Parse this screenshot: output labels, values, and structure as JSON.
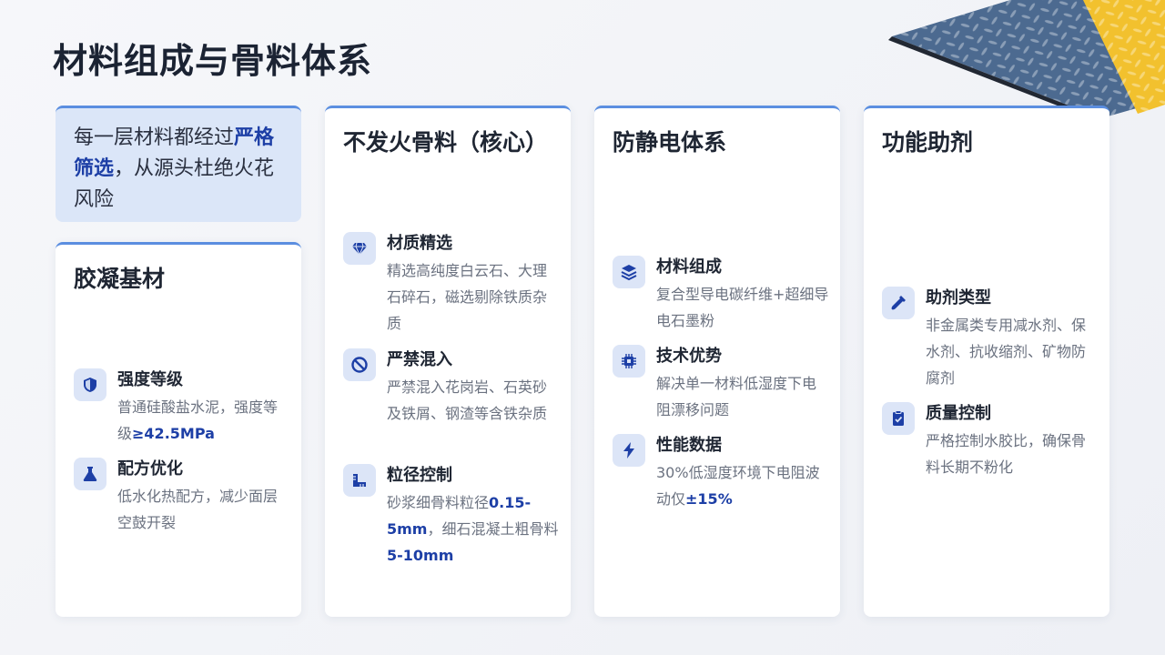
{
  "title": "材料组成与骨料体系",
  "intro": {
    "before": "每一层材料都经过",
    "highlight": "严格筛选",
    "after": "，从源头杜绝火花风险"
  },
  "cards": [
    {
      "title": "胶凝基材",
      "items": [
        {
          "icon": "shield-icon",
          "title": "强度等级",
          "desc_a": "普通硅酸盐水泥，强度等级",
          "num_a": "≥42.5MPa",
          "desc_b": "",
          "num_b": "",
          "desc_c": ""
        },
        {
          "icon": "flask-icon",
          "title": "配方优化",
          "desc_a": "低水化热配方，减少面层空鼓开裂",
          "num_a": "",
          "desc_b": "",
          "num_b": "",
          "desc_c": ""
        }
      ]
    },
    {
      "title": "不发火骨料（核心）",
      "items": [
        {
          "icon": "gem-icon",
          "title": "材质精选",
          "desc_a": "精选高纯度白云石、大理石碎石，磁选剔除铁质杂质",
          "num_a": "",
          "desc_b": "",
          "num_b": "",
          "desc_c": ""
        },
        {
          "icon": "ban-icon",
          "title": "严禁混入",
          "desc_a": "严禁混入花岗岩、石英砂及铁屑、钢渣等含铁杂质",
          "num_a": "",
          "desc_b": "",
          "num_b": "",
          "desc_c": ""
        },
        {
          "icon": "ruler-icon",
          "title": "粒径控制",
          "desc_a": "砂浆细骨料粒径",
          "num_a": "0.15-5mm",
          "desc_b": "，细石混凝土粗骨料",
          "num_b": "5-10mm",
          "desc_c": ""
        }
      ]
    },
    {
      "title": "防静电体系",
      "items": [
        {
          "icon": "layers-icon",
          "title": "材料组成",
          "desc_a": "复合型导电碳纤维+超细导电石墨粉",
          "num_a": "",
          "desc_b": "",
          "num_b": "",
          "desc_c": ""
        },
        {
          "icon": "chip-icon",
          "title": "技术优势",
          "desc_a": "解决单一材料低湿度下电阻漂移问题",
          "num_a": "",
          "desc_b": "",
          "num_b": "",
          "desc_c": ""
        },
        {
          "icon": "bolt-icon",
          "title": "性能数据",
          "desc_a": "30%低湿度环境下电阻波动仅",
          "num_a": "±15%",
          "desc_b": "",
          "num_b": "",
          "desc_c": ""
        }
      ]
    },
    {
      "title": "功能助剂",
      "items": [
        {
          "icon": "dropper-icon",
          "title": "助剂类型",
          "desc_a": "非金属类专用减水剂、保水剂、抗收缩剂、矿物防腐剂",
          "num_a": "",
          "desc_b": "",
          "num_b": "",
          "desc_c": ""
        },
        {
          "icon": "clipboard-check-icon",
          "title": "质量控制",
          "desc_a": "严格控制水胶比，确保骨料长期不粉化",
          "num_a": "",
          "desc_b": "",
          "num_b": "",
          "desc_c": ""
        }
      ]
    }
  ],
  "colors": {
    "accent": "#1d3fa6",
    "icon_bg": "#dce5f7",
    "intro_bg": "#dbe6f8"
  }
}
